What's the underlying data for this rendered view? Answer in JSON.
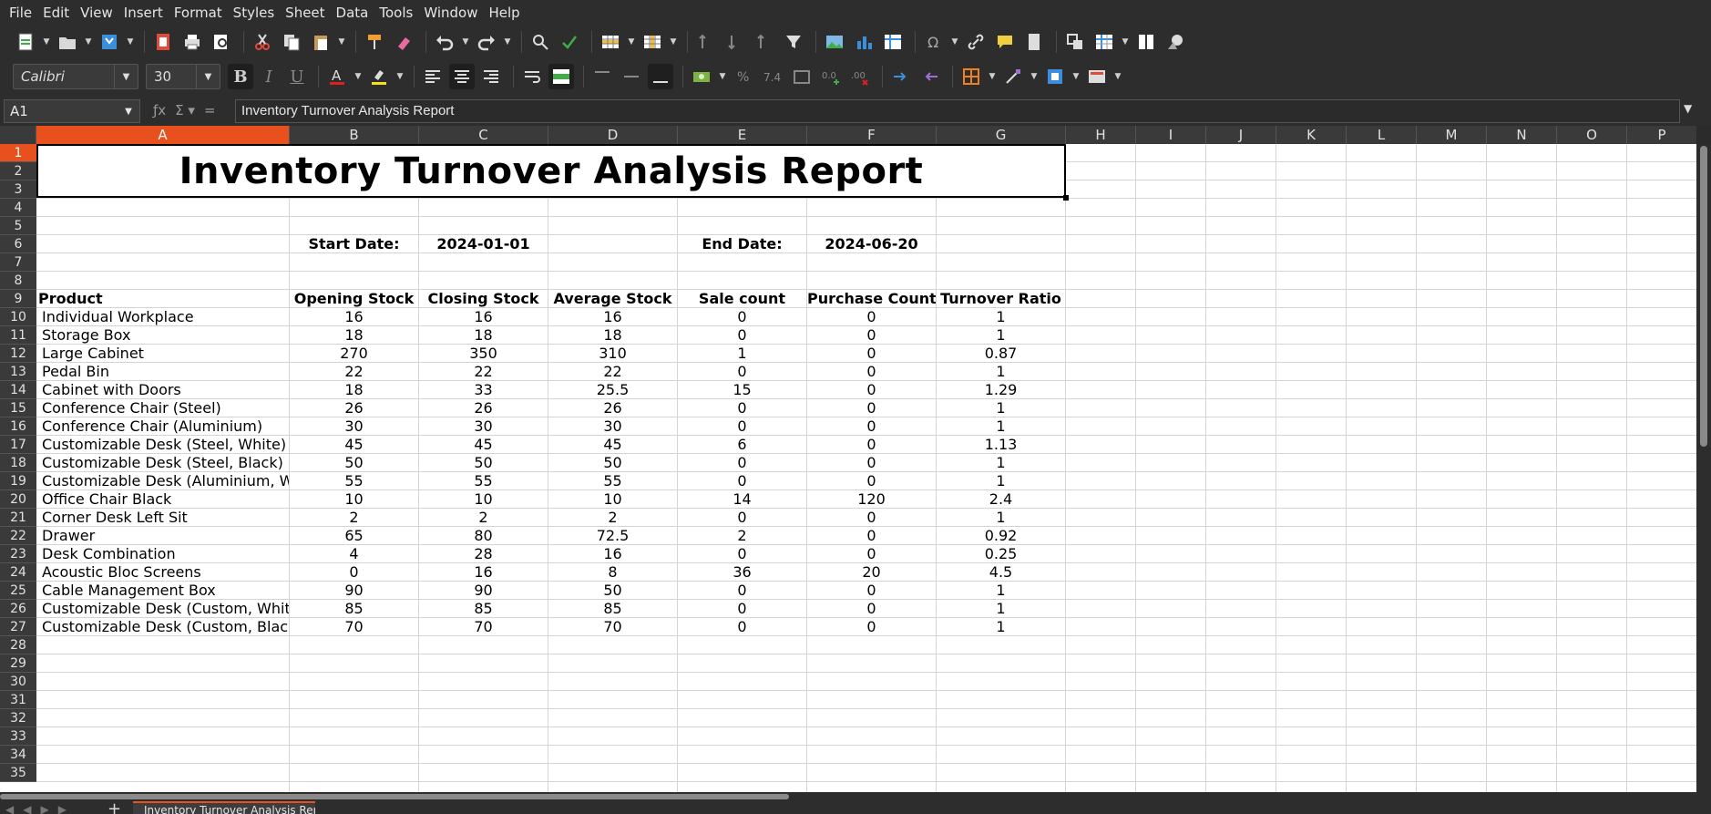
{
  "menu": [
    "File",
    "Edit",
    "View",
    "Insert",
    "Format",
    "Styles",
    "Sheet",
    "Data",
    "Tools",
    "Window",
    "Help"
  ],
  "font": {
    "name": "Calibri",
    "size": "30"
  },
  "formula_bar": {
    "cell_ref": "A1",
    "content": "Inventory Turnover Analysis Report"
  },
  "columns": [
    "A",
    "B",
    "C",
    "D",
    "E",
    "F",
    "G",
    "H",
    "I",
    "J",
    "K",
    "L",
    "M",
    "N",
    "O",
    "P"
  ],
  "selected_column": "A",
  "selected_row": "1",
  "rows": [
    "1",
    "2",
    "3",
    "4",
    "5",
    "6",
    "7",
    "8",
    "9",
    "10",
    "11",
    "12",
    "13",
    "14",
    "15",
    "16",
    "17",
    "18",
    "19",
    "20",
    "21",
    "22",
    "23",
    "24",
    "25",
    "26",
    "27",
    "28",
    "29",
    "30",
    "31",
    "32",
    "33",
    "34",
    "35"
  ],
  "sheet": {
    "title": "Inventory Turnover Analysis Report",
    "start_label": "Start Date:",
    "start_value": "2024-01-01",
    "end_label": "End Date:",
    "end_value": "2024-06-20",
    "headers": [
      "Product",
      "Opening Stock",
      "Closing Stock",
      "Average Stock",
      "Sale count",
      "Purchase Count",
      "Turnover Ratio"
    ],
    "data": [
      [
        "Individual Workplace",
        "16",
        "16",
        "16",
        "0",
        "0",
        "1"
      ],
      [
        "Storage Box",
        "18",
        "18",
        "18",
        "0",
        "0",
        "1"
      ],
      [
        "Large Cabinet",
        "270",
        "350",
        "310",
        "1",
        "0",
        "0.87"
      ],
      [
        "Pedal Bin",
        "22",
        "22",
        "22",
        "0",
        "0",
        "1"
      ],
      [
        "Cabinet with Doors",
        "18",
        "33",
        "25.5",
        "15",
        "0",
        "1.29"
      ],
      [
        "Conference Chair (Steel)",
        "26",
        "26",
        "26",
        "0",
        "0",
        "1"
      ],
      [
        "Conference Chair (Aluminium)",
        "30",
        "30",
        "30",
        "0",
        "0",
        "1"
      ],
      [
        "Customizable Desk (Steel, White)",
        "45",
        "45",
        "45",
        "6",
        "0",
        "1.13"
      ],
      [
        "Customizable Desk (Steel, Black)",
        "50",
        "50",
        "50",
        "0",
        "0",
        "1"
      ],
      [
        "Customizable Desk (Aluminium, Wh",
        "55",
        "55",
        "55",
        "0",
        "0",
        "1"
      ],
      [
        "Office Chair Black",
        "10",
        "10",
        "10",
        "14",
        "120",
        "2.4"
      ],
      [
        "Corner Desk Left Sit",
        "2",
        "2",
        "2",
        "0",
        "0",
        "1"
      ],
      [
        "Drawer",
        "65",
        "80",
        "72.5",
        "2",
        "0",
        "0.92"
      ],
      [
        "Desk Combination",
        "4",
        "28",
        "16",
        "0",
        "0",
        "0.25"
      ],
      [
        "Acoustic Bloc Screens",
        "0",
        "16",
        "8",
        "36",
        "20",
        "4.5"
      ],
      [
        "Cable Management Box",
        "90",
        "90",
        "50",
        "0",
        "0",
        "1"
      ],
      [
        "Customizable Desk (Custom, White",
        "85",
        "85",
        "85",
        "0",
        "0",
        "1"
      ],
      [
        "Customizable Desk (Custom, Black)",
        "70",
        "70",
        "70",
        "0",
        "0",
        "1"
      ]
    ]
  },
  "sheet_tab": "Inventory Turnover Analysis Rep",
  "colors": {
    "accent": "#e8501e",
    "toolbar_bg": "#2d2d2d"
  }
}
